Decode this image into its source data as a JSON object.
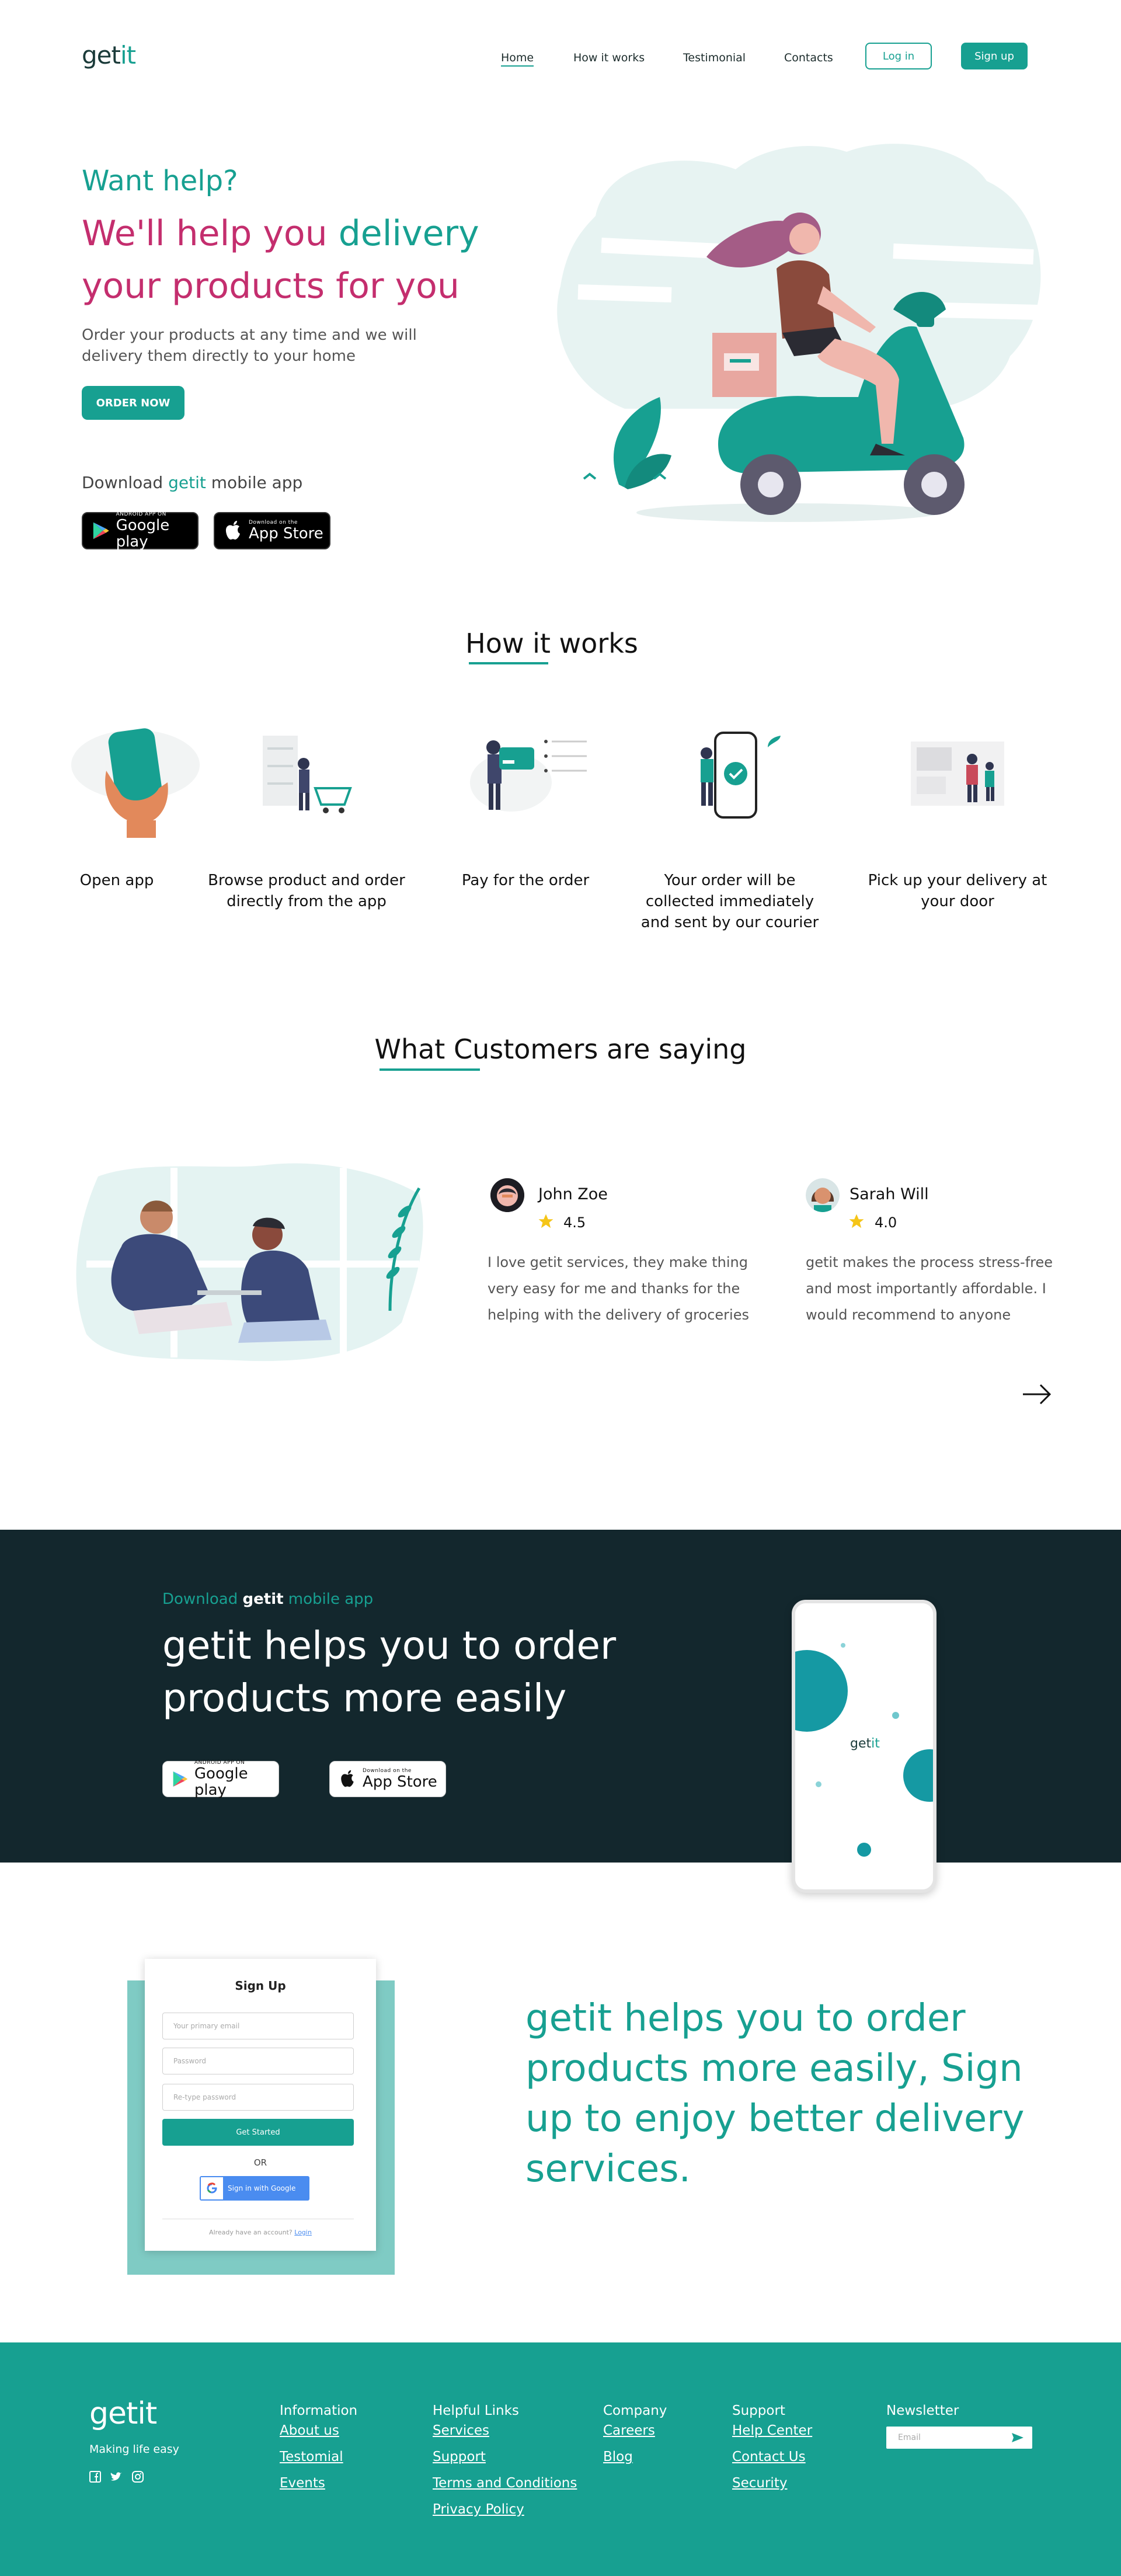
{
  "brand": {
    "name_prefix": "get",
    "name_suffix": "it",
    "tagline": "Making life easy"
  },
  "nav": {
    "items": [
      {
        "label": "Home",
        "active": true
      },
      {
        "label": "How it works"
      },
      {
        "label": "Testimonial"
      },
      {
        "label": "Contacts"
      }
    ],
    "login_label": "Log in",
    "signup_label": "Sign up"
  },
  "hero": {
    "pre_title": "Want help?",
    "title_part1": "We'll help you ",
    "title_highlight": "delivery",
    "title_part2": "your products for you",
    "description": "Order your products at any time and we will delivery them directly to your home",
    "cta_label": "ORDER NOW",
    "download_prefix": "Download ",
    "download_brand": "getit",
    "download_suffix": " mobile app",
    "google_small": "ANDROID APP ON",
    "google_big": "Google play",
    "apple_small": "Download on the",
    "apple_big": "App Store"
  },
  "how_it_works": {
    "title": "How it works",
    "steps": [
      {
        "label": "Open app"
      },
      {
        "label": "Browse product and order directly from the app"
      },
      {
        "label": "Pay for the order"
      },
      {
        "label": "Your order will be collected immediately and sent by our courier"
      },
      {
        "label": "Pick up your delivery at your door"
      }
    ]
  },
  "testimonials": {
    "title": "What Customers are saying",
    "items": [
      {
        "name": "John Zoe",
        "rating": "4.5",
        "text": "I love getit services, they make thing very easy for me and thanks for the helping with the delivery of groceries"
      },
      {
        "name": "Sarah Will",
        "rating": "4.0",
        "text": "getit makes the process stress-free and most importantly affordable. I would recommend to anyone"
      }
    ]
  },
  "promo": {
    "pre_download": "Download ",
    "pre_brand": "getit",
    "pre_suffix": " mobile app",
    "title": "getit helps you to order products more easily",
    "phone_logo_prefix": "get",
    "phone_logo_suffix": "it"
  },
  "signup": {
    "title": "Sign Up",
    "email_placeholder": "Your primary email",
    "password_placeholder": "Password",
    "retype_placeholder": "Re-type password",
    "submit_label": "Get Started",
    "or_label": "OR",
    "google_label": "Sign in with Google",
    "have_account": "Already have an account?",
    "login_link": "Login",
    "cta_text": "getit helps you to order products more easily, Sign up to enjoy better delivery services."
  },
  "footer": {
    "columns": [
      {
        "title": "Information",
        "links": [
          "About us",
          "Testomial",
          "Events"
        ]
      },
      {
        "title": "Helpful Links",
        "links": [
          "Services",
          "Support",
          "Terms and Conditions",
          "Privacy Policy"
        ]
      },
      {
        "title": "Company",
        "links": [
          "Careers",
          "Blog"
        ]
      },
      {
        "title": "Support",
        "links": [
          "Help Center",
          "Contact Us",
          "Security"
        ]
      }
    ],
    "newsletter_title": "Newsletter",
    "newsletter_placeholder": "Email"
  },
  "colors": {
    "teal": "#17a091",
    "pink": "#c42e6e",
    "dark": "#13272d"
  },
  "icons": [
    "facebook-icon",
    "twitter-icon",
    "instagram-icon",
    "star-icon",
    "arrow-right-icon",
    "send-icon",
    "google-play-icon",
    "apple-icon",
    "google-g-icon"
  ]
}
